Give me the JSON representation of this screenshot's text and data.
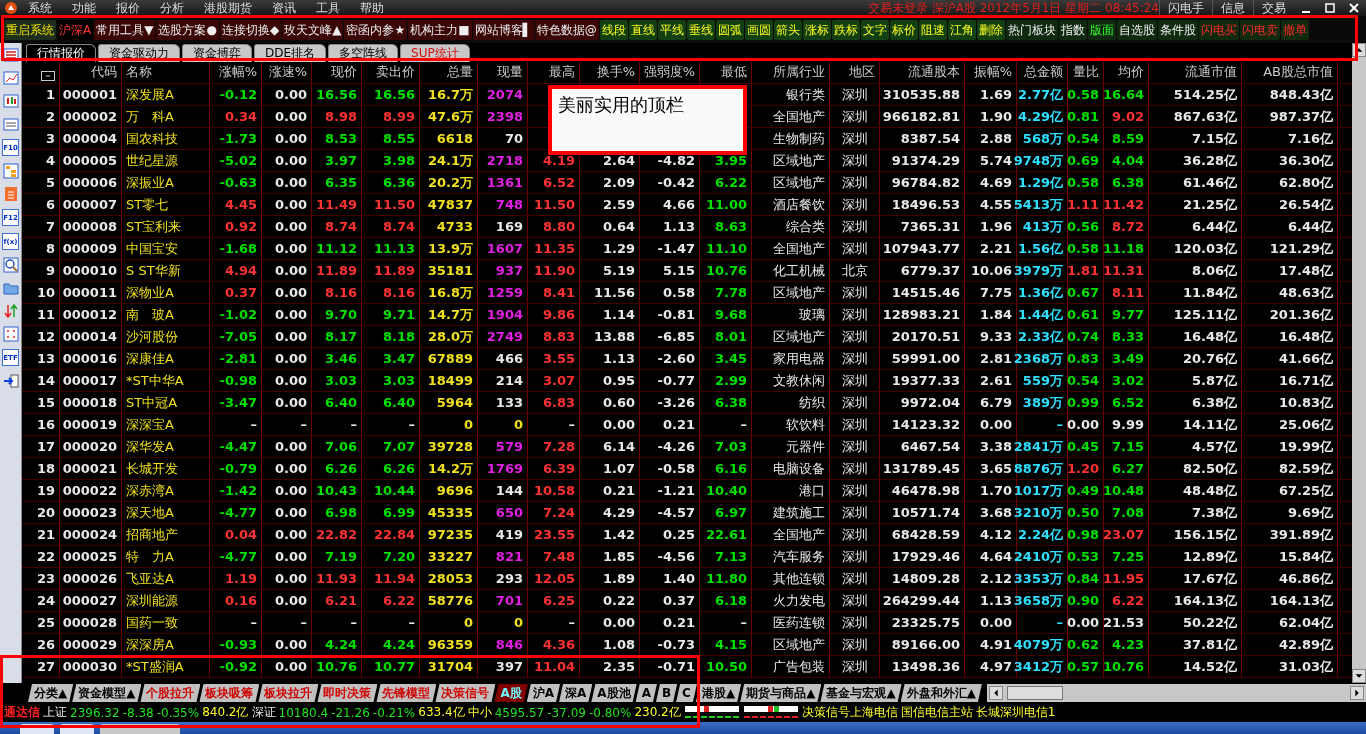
{
  "menu_bar": {
    "items": [
      "系统",
      "功能",
      "报价",
      "分析",
      "港股期货",
      "资讯",
      "工具",
      "帮助"
    ],
    "title": "交易未登录  深沪A股  2012年5月1日  星期二  08:45:24",
    "buttons": [
      "闪电手",
      "信息",
      "交易"
    ]
  },
  "toolbar": {
    "items": [
      {
        "label": "重启系统",
        "kind": "system"
      },
      {
        "label": "沪深A",
        "kind": "market"
      },
      {
        "label": "常用工具▼",
        "kind": "menu"
      },
      {
        "label": "选股方案●",
        "kind": "menu"
      },
      {
        "label": "连接切换◆",
        "kind": "menu"
      },
      {
        "label": "玫天文峰▲",
        "kind": "menu"
      },
      {
        "label": "密函内参★",
        "kind": "menu"
      },
      {
        "label": "机构主力■",
        "kind": "menu"
      },
      {
        "label": "网站博客▌",
        "kind": "menu"
      },
      {
        "label": "特色数据@",
        "kind": "menu"
      },
      {
        "label": "线段",
        "kind": "draw"
      },
      {
        "label": "直线",
        "kind": "draw"
      },
      {
        "label": "平线",
        "kind": "draw"
      },
      {
        "label": "垂线",
        "kind": "draw"
      },
      {
        "label": "圆弧",
        "kind": "draw"
      },
      {
        "label": "画圆",
        "kind": "draw"
      },
      {
        "label": "箭头",
        "kind": "draw"
      },
      {
        "label": "涨标",
        "kind": "draw"
      },
      {
        "label": "跌标",
        "kind": "draw"
      },
      {
        "label": "文字",
        "kind": "draw"
      },
      {
        "label": "标价",
        "kind": "draw"
      },
      {
        "label": "阻速",
        "kind": "draw"
      },
      {
        "label": "江角",
        "kind": "draw"
      },
      {
        "label": "删除",
        "kind": "draw"
      },
      {
        "label": "热门板块",
        "kind": "view"
      },
      {
        "label": "指数",
        "kind": "view"
      },
      {
        "label": "版面",
        "kind": "layout"
      },
      {
        "label": "自选股",
        "kind": "view"
      },
      {
        "label": "条件股",
        "kind": "view"
      },
      {
        "label": "闪电买",
        "kind": "trade"
      },
      {
        "label": "闪电卖",
        "kind": "trade"
      },
      {
        "label": "撤单",
        "kind": "trade"
      }
    ]
  },
  "sidebar": {
    "items": [
      {
        "kind": "grid"
      },
      {
        "kind": "line"
      },
      {
        "kind": "candle"
      },
      {
        "kind": "window"
      },
      {
        "kind": "label",
        "label": "F10"
      },
      {
        "kind": "tree"
      },
      {
        "kind": "note"
      },
      {
        "kind": "label",
        "label": "F12"
      },
      {
        "kind": "label",
        "label": "f(x)"
      },
      {
        "kind": "search"
      },
      {
        "kind": "folder"
      },
      {
        "kind": "arrows"
      },
      {
        "kind": "target"
      },
      {
        "kind": "label",
        "label": "ETF"
      },
      {
        "kind": "export"
      }
    ]
  },
  "tabs": [
    {
      "label": "行情报价",
      "selected": true
    },
    {
      "label": "资金驱动力",
      "selected": false
    },
    {
      "label": "资金搏弈",
      "selected": false
    },
    {
      "label": "DDE排名",
      "selected": false
    },
    {
      "label": "多空阵线",
      "selected": false
    },
    {
      "label": "SUP统计",
      "selected": false,
      "kind": "special"
    }
  ],
  "table": {
    "columns": [
      "代码",
      "名称",
      "涨幅%",
      "涨速%",
      "现价",
      "卖出价",
      "总量",
      "现量",
      "最高",
      "换手%",
      "强弱度%",
      "最低",
      "所属行业",
      "地区",
      "流通股本",
      "振幅%",
      "总金额",
      "量比",
      "均价",
      "流通市值",
      "AB股总市值"
    ],
    "rows": [
      {
        "index": "1",
        "kind": "fall",
        "big_volume": true,
        "ratio_high": false,
        "cells": [
          "000001",
          "深发展A",
          "-0.12",
          "0.00",
          "16.56",
          "16.56",
          "16.7万",
          "2074",
          null,
          null,
          null,
          null,
          "银行类",
          "深圳",
          "310535.88",
          "1.69",
          "2.77亿",
          "0.58",
          "16.64",
          "514.25亿",
          "848.43亿"
        ]
      },
      {
        "index": "2",
        "kind": "rise",
        "big_volume": true,
        "ratio_high": false,
        "cells": [
          "000002",
          "万　科A",
          "0.34",
          "0.00",
          "8.98",
          "8.99",
          "47.6万",
          "2398",
          null,
          null,
          null,
          null,
          "全国地产",
          "深圳",
          "966182.81",
          "1.90",
          "4.29亿",
          "0.81",
          "9.02",
          "867.63亿",
          "987.37亿"
        ]
      },
      {
        "index": "3",
        "kind": "fall",
        "big_volume": false,
        "ratio_high": false,
        "cells": [
          "000004",
          "国农科技",
          "-1.73",
          "0.00",
          "8.53",
          "8.55",
          "6618",
          "70",
          null,
          null,
          null,
          null,
          "生物制药",
          "深圳",
          "8387.54",
          "2.88",
          "568万",
          "0.54",
          "8.59",
          "7.15亿",
          "7.16亿"
        ]
      },
      {
        "index": "4",
        "kind": "fall",
        "big_volume": true,
        "ratio_high": false,
        "cells": [
          "000005",
          "世纪星源",
          "-5.02",
          "0.00",
          "3.97",
          "3.98",
          "24.1万",
          "2718",
          "4.19",
          "2.64",
          "-4.82",
          "3.95",
          "区域地产",
          "深圳",
          "91374.29",
          "5.74",
          "9748万",
          "0.69",
          "4.04",
          "36.28亿",
          "36.30亿"
        ]
      },
      {
        "index": "5",
        "kind": "fall",
        "big_volume": true,
        "ratio_high": false,
        "cells": [
          "000006",
          "深振业A",
          "-0.63",
          "0.00",
          "6.35",
          "6.36",
          "20.2万",
          "1361",
          "6.52",
          "2.09",
          "-0.42",
          "6.22",
          "区域地产",
          "深圳",
          "96784.82",
          "4.69",
          "1.29亿",
          "0.58",
          "6.38",
          "61.46亿",
          "62.80亿"
        ]
      },
      {
        "index": "6",
        "kind": "rise",
        "big_volume": true,
        "ratio_high": true,
        "cells": [
          "000007",
          "ST零七",
          "4.45",
          "0.00",
          "11.49",
          "11.50",
          "47837",
          "748",
          "11.50",
          "2.59",
          "4.66",
          "11.00",
          "酒店餐饮",
          "深圳",
          "18496.53",
          "4.55",
          "5413万",
          "1.11",
          "11.42",
          "21.25亿",
          "26.54亿"
        ]
      },
      {
        "index": "7",
        "kind": "rise",
        "big_volume": false,
        "ratio_high": false,
        "cells": [
          "000008",
          "ST宝利来",
          "0.92",
          "0.00",
          "8.74",
          "8.74",
          "4733",
          "169",
          "8.80",
          "0.64",
          "1.13",
          "8.63",
          "综合类",
          "深圳",
          "7365.31",
          "1.96",
          "413万",
          "0.56",
          "8.72",
          "6.44亿",
          "6.44亿"
        ]
      },
      {
        "index": "8",
        "kind": "fall",
        "big_volume": true,
        "ratio_high": false,
        "cells": [
          "000009",
          "中国宝安",
          "-1.68",
          "0.00",
          "11.12",
          "11.13",
          "13.9万",
          "1607",
          "11.35",
          "1.29",
          "-1.47",
          "11.10",
          "全国地产",
          "深圳",
          "107943.77",
          "2.21",
          "1.56亿",
          "0.58",
          "11.18",
          "120.03亿",
          "121.29亿"
        ]
      },
      {
        "index": "9",
        "kind": "rise",
        "big_volume": true,
        "ratio_high": true,
        "cells": [
          "000010",
          "S ST华新",
          "4.94",
          "0.00",
          "11.89",
          "11.89",
          "35181",
          "937",
          "11.90",
          "5.19",
          "5.15",
          "10.76",
          "化工机械",
          "北京",
          "6779.37",
          "10.06",
          "3979万",
          "1.81",
          "11.31",
          "8.06亿",
          "17.48亿"
        ]
      },
      {
        "index": "10",
        "kind": "rise",
        "big_volume": true,
        "ratio_high": false,
        "cells": [
          "000011",
          "深物业A",
          "0.37",
          "0.00",
          "8.16",
          "8.16",
          "16.8万",
          "1259",
          "8.41",
          "11.56",
          "0.58",
          "7.78",
          "区域地产",
          "深圳",
          "14515.46",
          "7.75",
          "1.36亿",
          "0.67",
          "8.11",
          "11.84亿",
          "48.63亿"
        ]
      },
      {
        "index": "11",
        "kind": "fall",
        "big_volume": true,
        "ratio_high": false,
        "cells": [
          "000012",
          "南　玻A",
          "-1.02",
          "0.00",
          "9.70",
          "9.71",
          "14.7万",
          "1904",
          "9.86",
          "1.14",
          "-0.81",
          "9.68",
          "玻璃",
          "深圳",
          "128983.21",
          "1.84",
          "1.44亿",
          "0.61",
          "9.77",
          "125.11亿",
          "201.36亿"
        ]
      },
      {
        "index": "12",
        "kind": "fall",
        "big_volume": true,
        "ratio_high": false,
        "cells": [
          "000014",
          "沙河股份",
          "-7.05",
          "0.00",
          "8.17",
          "8.18",
          "28.0万",
          "2749",
          "8.83",
          "13.88",
          "-6.85",
          "8.01",
          "区域地产",
          "深圳",
          "20170.51",
          "9.33",
          "2.33亿",
          "0.74",
          "8.33",
          "16.48亿",
          "16.48亿"
        ]
      },
      {
        "index": "13",
        "kind": "fall",
        "big_volume": false,
        "ratio_high": false,
        "cells": [
          "000016",
          "深康佳A",
          "-2.81",
          "0.00",
          "3.46",
          "3.47",
          "67889",
          "466",
          "3.55",
          "1.13",
          "-2.60",
          "3.45",
          "家用电器",
          "深圳",
          "59991.00",
          "2.81",
          "2368万",
          "0.83",
          "3.49",
          "20.76亿",
          "41.66亿"
        ]
      },
      {
        "index": "14",
        "kind": "fall",
        "big_volume": false,
        "ratio_high": false,
        "cells": [
          "000017",
          "*ST中华A",
          "-0.98",
          "0.00",
          "3.03",
          "3.03",
          "18499",
          "214",
          "3.07",
          "0.95",
          "-0.77",
          "2.99",
          "文教休闲",
          "深圳",
          "19377.33",
          "2.61",
          "559万",
          "0.54",
          "3.02",
          "5.87亿",
          "16.71亿"
        ]
      },
      {
        "index": "15",
        "kind": "fall",
        "big_volume": false,
        "ratio_high": false,
        "cells": [
          "000018",
          "ST中冠A",
          "-3.47",
          "0.00",
          "6.40",
          "6.40",
          "5964",
          "133",
          "6.83",
          "0.60",
          "-3.26",
          "6.38",
          "纺织",
          "深圳",
          "9972.04",
          "6.79",
          "389万",
          "0.99",
          "6.52",
          "6.38亿",
          "10.83亿"
        ]
      },
      {
        "index": "16",
        "kind": "flat",
        "cells": [
          "000019",
          "深深宝A",
          "–",
          "–",
          "–",
          "–",
          "0",
          "0",
          "–",
          "0.00",
          "0.21",
          "–",
          "软饮料",
          "深圳",
          "14123.32",
          "0.00",
          "–",
          "0.00",
          "9.99",
          "14.11亿",
          "25.06亿"
        ]
      },
      {
        "index": "17",
        "kind": "fall",
        "big_volume": true,
        "ratio_high": false,
        "cells": [
          "000020",
          "深华发A",
          "-4.47",
          "0.00",
          "7.06",
          "7.07",
          "39728",
          "579",
          "7.28",
          "6.14",
          "-4.26",
          "7.03",
          "元器件",
          "深圳",
          "6467.54",
          "3.38",
          "2841万",
          "0.45",
          "7.15",
          "4.57亿",
          "19.99亿"
        ]
      },
      {
        "index": "18",
        "kind": "fall",
        "big_volume": true,
        "ratio_high": true,
        "cells": [
          "000021",
          "长城开发",
          "-0.79",
          "0.00",
          "6.26",
          "6.26",
          "14.2万",
          "1769",
          "6.39",
          "1.07",
          "-0.58",
          "6.16",
          "电脑设备",
          "深圳",
          "131789.45",
          "3.65",
          "8876万",
          "1.20",
          "6.27",
          "82.50亿",
          "82.59亿"
        ]
      },
      {
        "index": "19",
        "kind": "fall",
        "big_volume": false,
        "ratio_high": false,
        "cells": [
          "000022",
          "深赤湾A",
          "-1.42",
          "0.00",
          "10.43",
          "10.44",
          "9696",
          "144",
          "10.58",
          "0.21",
          "-1.21",
          "10.40",
          "港口",
          "深圳",
          "46478.98",
          "1.70",
          "1017万",
          "0.49",
          "10.48",
          "48.48亿",
          "67.25亿"
        ]
      },
      {
        "index": "20",
        "kind": "fall",
        "big_volume": true,
        "ratio_high": false,
        "cells": [
          "000023",
          "深天地A",
          "-4.77",
          "0.00",
          "6.98",
          "6.99",
          "45335",
          "650",
          "7.24",
          "4.29",
          "-4.57",
          "6.97",
          "建筑施工",
          "深圳",
          "10571.74",
          "3.68",
          "3210万",
          "0.50",
          "7.08",
          "7.38亿",
          "9.69亿"
        ]
      },
      {
        "index": "21",
        "kind": "rise",
        "big_volume": false,
        "ratio_high": false,
        "cells": [
          "000024",
          "招商地产",
          "0.04",
          "0.00",
          "22.82",
          "22.84",
          "97235",
          "419",
          "23.55",
          "1.42",
          "0.25",
          "22.61",
          "全国地产",
          "深圳",
          "68428.59",
          "4.12",
          "2.24亿",
          "0.98",
          "23.07",
          "156.15亿",
          "391.89亿"
        ]
      },
      {
        "index": "22",
        "kind": "fall",
        "big_volume": true,
        "ratio_high": false,
        "cells": [
          "000025",
          "特　力A",
          "-4.77",
          "0.00",
          "7.19",
          "7.20",
          "33227",
          "821",
          "7.48",
          "1.85",
          "-4.56",
          "7.13",
          "汽车服务",
          "深圳",
          "17929.46",
          "4.64",
          "2410万",
          "0.53",
          "7.25",
          "12.89亿",
          "15.84亿"
        ]
      },
      {
        "index": "23",
        "kind": "rise",
        "big_volume": false,
        "ratio_high": false,
        "cells": [
          "000026",
          "飞亚达A",
          "1.19",
          "0.00",
          "11.93",
          "11.94",
          "28053",
          "293",
          "12.05",
          "1.89",
          "1.40",
          "11.80",
          "其他连锁",
          "深圳",
          "14809.28",
          "2.12",
          "3353万",
          "0.84",
          "11.95",
          "17.67亿",
          "46.86亿"
        ]
      },
      {
        "index": "24",
        "kind": "rise",
        "big_volume": true,
        "ratio_high": false,
        "cells": [
          "000027",
          "深圳能源",
          "0.16",
          "0.00",
          "6.21",
          "6.22",
          "58776",
          "701",
          "6.25",
          "0.22",
          "0.37",
          "6.18",
          "火力发电",
          "深圳",
          "264299.44",
          "1.13",
          "3658万",
          "0.90",
          "6.22",
          "164.13亿",
          "164.13亿"
        ]
      },
      {
        "index": "25",
        "kind": "flat",
        "cells": [
          "000028",
          "国药一致",
          "–",
          "–",
          "–",
          "–",
          "0",
          "0",
          "–",
          "0.00",
          "0.21",
          "–",
          "医药连锁",
          "深圳",
          "23325.75",
          "0.00",
          "–",
          "0.00",
          "21.53",
          "50.22亿",
          "62.04亿"
        ]
      },
      {
        "index": "26",
        "kind": "fall",
        "big_volume": true,
        "ratio_high": false,
        "cells": [
          "000029",
          "深深房A",
          "-0.93",
          "0.00",
          "4.24",
          "4.24",
          "96359",
          "846",
          "4.36",
          "1.08",
          "-0.73",
          "4.15",
          "区域地产",
          "深圳",
          "89166.00",
          "4.91",
          "4079万",
          "0.62",
          "4.23",
          "37.81亿",
          "42.89亿"
        ]
      },
      {
        "index": "27",
        "kind": "fall",
        "big_volume": false,
        "ratio_high": false,
        "cells": [
          "000030",
          "*ST盛润A",
          "-0.92",
          "0.00",
          "10.76",
          "10.77",
          "31704",
          "397",
          "11.04",
          "2.35",
          "-0.71",
          "10.50",
          "广告包装",
          "深圳",
          "13498.36",
          "4.97",
          "3412万",
          "0.57",
          "10.76",
          "14.52亿",
          "31.03亿"
        ]
      }
    ]
  },
  "callout": {
    "text": "美丽实用的顶栏"
  },
  "bottom_tabs": [
    {
      "label": "分类▲",
      "selected": false
    },
    {
      "label": "资金模型▲",
      "selected": false
    },
    {
      "label": "个股拉升",
      "selected": false,
      "kind": "model"
    },
    {
      "label": "板块吸筹",
      "selected": false,
      "kind": "model"
    },
    {
      "label": "板块拉升",
      "selected": false,
      "kind": "model"
    },
    {
      "label": "即时决策",
      "selected": false,
      "kind": "model"
    },
    {
      "label": "先锋模型",
      "selected": false,
      "kind": "model"
    },
    {
      "label": "决策信号",
      "selected": false,
      "kind": "model"
    },
    {
      "label": "A股",
      "selected": true
    },
    {
      "label": "沪A",
      "selected": false
    },
    {
      "label": "深A",
      "selected": false
    },
    {
      "label": "A股池",
      "selected": false
    },
    {
      "label": "A",
      "selected": false
    },
    {
      "label": "B",
      "selected": false
    },
    {
      "label": "C",
      "selected": false
    },
    {
      "label": "港股▲",
      "selected": false
    },
    {
      "label": "期货与商品▲",
      "selected": false
    },
    {
      "label": "基金与宏观▲",
      "selected": false
    },
    {
      "label": "外盘和外汇▲",
      "selected": false
    }
  ],
  "status_bar": {
    "items": [
      {
        "text": "通达信",
        "kind": "brand"
      },
      {
        "text": "上证",
        "kind": "label"
      },
      {
        "text": "2396.32",
        "kind": "down"
      },
      {
        "text": "-8.38",
        "kind": "down"
      },
      {
        "text": "-0.35%",
        "kind": "down"
      },
      {
        "text": "840.2亿",
        "kind": "amount"
      },
      {
        "text": "深证",
        "kind": "label"
      },
      {
        "text": "10180.4",
        "kind": "down"
      },
      {
        "text": "-21.26",
        "kind": "down"
      },
      {
        "text": "-0.21%",
        "kind": "down"
      },
      {
        "text": "633.4亿",
        "kind": "amount"
      },
      {
        "text": "中小",
        "kind": "amount"
      },
      {
        "text": "4595.57",
        "kind": "down"
      },
      {
        "text": "-37.09",
        "kind": "down"
      },
      {
        "text": "-0.80%",
        "kind": "down"
      },
      {
        "text": "230.2亿",
        "kind": "amount"
      }
    ],
    "servers": [
      "决策信号上海电信",
      "国信电信主站",
      "长城深圳电信1"
    ]
  }
}
